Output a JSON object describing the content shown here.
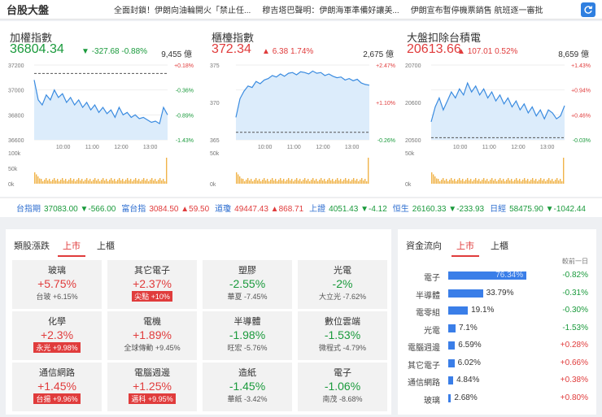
{
  "header": {
    "title": "台股大盤",
    "news": [
      "全面封鎖！伊朗向油輪開火「禁止任...",
      "穆吉塔巴聲明：伊朗海軍準備好讓美...",
      "伊朗宣布暫停機票銷售 航班逐一審批"
    ]
  },
  "indices": [
    {
      "name": "加權指數",
      "value": "36804.34",
      "arrow": "▼",
      "chg": "-327.68",
      "pct": "-0.88%",
      "dir": "down",
      "vol": "9,455 億",
      "chart_data": {
        "type": "line",
        "y_ticks": [
          "37200",
          "37000",
          "36800",
          "36600"
        ],
        "right_ticks": [
          "+0.18%",
          "-0.36%",
          "-0.89%",
          "-1.43%"
        ],
        "x_ticks": [
          "10:00",
          "11:00",
          "12:00",
          "13:00"
        ],
        "vol_ticks": [
          "100k",
          "50k",
          "0k"
        ],
        "ylim": [
          36600,
          37200
        ],
        "ref": 37132,
        "values": [
          37080,
          36920,
          36880,
          36960,
          36920,
          37000,
          36940,
          36970,
          36900,
          36940,
          36880,
          36920,
          36860,
          36900,
          36840,
          36880,
          36820,
          36860,
          36810,
          36840,
          36780,
          36860,
          36800,
          36820,
          36780,
          36800,
          36770,
          36780,
          36760,
          36740,
          36750,
          36730,
          36860,
          36800
        ]
      }
    },
    {
      "name": "櫃檯指數",
      "value": "372.34",
      "arrow": "▲",
      "chg": "6.38",
      "pct": "1.74%",
      "dir": "up",
      "vol": "2,675 億",
      "chart_data": {
        "type": "line",
        "y_ticks": [
          "375",
          "370",
          "365"
        ],
        "right_ticks": [
          "+2.47%",
          "+1.10%",
          "-0.26%"
        ],
        "x_ticks": [
          "10:00",
          "11:00",
          "12:00",
          "13:00"
        ],
        "vol_ticks": [
          "50k",
          "0k"
        ],
        "ylim": [
          365,
          375
        ],
        "ref": 366,
        "values": [
          368.0,
          370.5,
          371.5,
          372.2,
          372.0,
          372.8,
          372.5,
          373.0,
          373.2,
          373.6,
          373.4,
          373.8,
          373.5,
          373.9,
          374.0,
          373.7,
          374.1,
          374.0,
          373.8,
          374.2,
          373.9,
          374.0,
          373.6,
          373.8,
          373.5,
          373.3,
          373.4,
          373.0,
          373.2,
          372.9,
          373.1,
          372.6,
          372.4,
          372.3
        ]
      }
    },
    {
      "name": "大盤扣除台積電",
      "value": "20613.66",
      "arrow": "▲",
      "chg": "107.01",
      "pct": "0.52%",
      "dir": "up",
      "vol": "8,659 億",
      "chart_data": {
        "type": "line",
        "y_ticks": [
          "20700",
          "20600",
          "20500"
        ],
        "right_ticks": [
          "+1.43%",
          "+0.94%",
          "+0.46%",
          "-0.03%"
        ],
        "x_ticks": [
          "10:00",
          "11:00",
          "12:00",
          "13:00"
        ],
        "vol_ticks": [
          "50k",
          "0k"
        ],
        "ylim": [
          20500,
          20750
        ],
        "ref": 20507,
        "values": [
          20560,
          20610,
          20640,
          20600,
          20630,
          20660,
          20640,
          20670,
          20650,
          20690,
          20660,
          20680,
          20650,
          20670,
          20640,
          20660,
          20630,
          20650,
          20620,
          20640,
          20610,
          20630,
          20600,
          20620,
          20590,
          20610,
          20580,
          20600,
          20570,
          20600,
          20590,
          20570,
          20580,
          20614
        ]
      }
    }
  ],
  "ticker": [
    {
      "name": "台指期",
      "value": "37083.00",
      "arrow": "▼",
      "chg": "-566.00",
      "dir": "down"
    },
    {
      "name": "富台指",
      "value": "3084.50",
      "arrow": "▲",
      "chg": "59.50",
      "dir": "up"
    },
    {
      "name": "道瓊",
      "value": "49447.43",
      "arrow": "▲",
      "chg": "868.71",
      "dir": "up"
    },
    {
      "name": "上證",
      "value": "4051.43",
      "arrow": "▼",
      "chg": "-4.12",
      "dir": "down"
    },
    {
      "name": "恒生",
      "value": "26160.33",
      "arrow": "▼",
      "chg": "-233.93",
      "dir": "down"
    },
    {
      "name": "日經",
      "value": "58475.90",
      "arrow": "▼",
      "chg": "-1042.44",
      "dir": "down"
    }
  ],
  "sectors": {
    "title": "類股漲跌",
    "tabs": [
      "上市",
      "上櫃"
    ],
    "items": [
      {
        "name": "玻璃",
        "pct": "+5.75%",
        "dir": "up",
        "lead": "台玻",
        "lead_pct": "+6.15%",
        "badge": false
      },
      {
        "name": "其它電子",
        "pct": "+2.37%",
        "dir": "up",
        "lead": "尖點",
        "lead_pct": "+10%",
        "badge": true
      },
      {
        "name": "塑膠",
        "pct": "-2.55%",
        "dir": "down",
        "lead": "華夏",
        "lead_pct": "-7.45%",
        "badge": false
      },
      {
        "name": "光電",
        "pct": "-2%",
        "dir": "down",
        "lead": "大立光",
        "lead_pct": "-7.62%",
        "badge": false
      },
      {
        "name": "化學",
        "pct": "+2.3%",
        "dir": "up",
        "lead": "永光",
        "lead_pct": "+9.98%",
        "badge": true
      },
      {
        "name": "電機",
        "pct": "+1.89%",
        "dir": "up",
        "lead": "全球傳動",
        "lead_pct": "+9.45%",
        "badge": false
      },
      {
        "name": "半導體",
        "pct": "-1.98%",
        "dir": "down",
        "lead": "旺宏",
        "lead_pct": "-5.76%",
        "badge": false
      },
      {
        "name": "數位雲端",
        "pct": "-1.53%",
        "dir": "down",
        "lead": "微程式",
        "lead_pct": "-4.79%",
        "badge": false
      },
      {
        "name": "通信網路",
        "pct": "+1.45%",
        "dir": "up",
        "lead": "台揚",
        "lead_pct": "+9.96%",
        "badge": true
      },
      {
        "name": "電腦週邊",
        "pct": "+1.25%",
        "dir": "up",
        "lead": "邁科",
        "lead_pct": "+9.95%",
        "badge": true
      },
      {
        "name": "造紙",
        "pct": "-1.45%",
        "dir": "down",
        "lead": "華紙",
        "lead_pct": "-3.42%",
        "badge": false
      },
      {
        "name": "電子",
        "pct": "-1.06%",
        "dir": "down",
        "lead": "南茂",
        "lead_pct": "-8.68%",
        "badge": false
      }
    ]
  },
  "flow": {
    "title": "資金流向",
    "tabs": [
      "上市",
      "上櫃"
    ],
    "date": "較前一日",
    "chart_data": {
      "type": "bar",
      "categories": [
        "電子",
        "半導體",
        "電零組",
        "光電",
        "電腦週邊",
        "其它電子",
        "通信網路",
        "玻璃"
      ],
      "values": [
        76.34,
        33.79,
        19.1,
        7.1,
        6.59,
        6.02,
        4.84,
        2.68
      ],
      "labels": [
        "76.34%",
        "33.79%",
        "19.1%",
        "7.1%",
        "6.59%",
        "6.02%",
        "4.84%",
        "2.68%"
      ],
      "delta": [
        "-0.82%",
        "-0.31%",
        "-0.30%",
        "-1.53%",
        "+0.28%",
        "+0.66%",
        "+0.38%",
        "+0.80%"
      ],
      "delta_dir": [
        "down",
        "down",
        "down",
        "down",
        "up",
        "up",
        "up",
        "up"
      ],
      "xlim": [
        0,
        100
      ]
    }
  }
}
